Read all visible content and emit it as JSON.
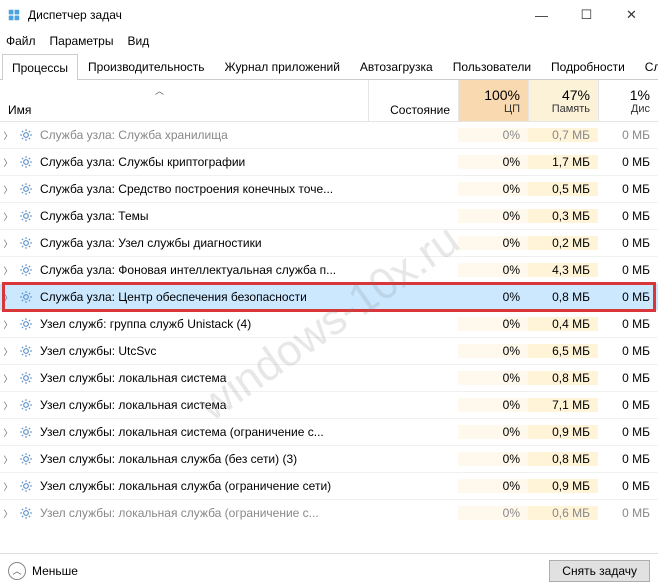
{
  "window": {
    "title": "Диспетчер задач"
  },
  "menu": {
    "file": "Файл",
    "options": "Параметры",
    "view": "Вид"
  },
  "tabs": {
    "processes": "Процессы",
    "performance": "Производительность",
    "app_history": "Журнал приложений",
    "startup": "Автозагрузка",
    "users": "Пользователи",
    "details": "Подробности",
    "services": "Службы"
  },
  "columns": {
    "name": "Имя",
    "status": "Состояние",
    "cpu_pct": "100%",
    "cpu_label": "ЦП",
    "mem_pct": "47%",
    "mem_label": "Память",
    "disk_pct": "1%",
    "disk_label": "Дис"
  },
  "rows": [
    {
      "name": "Служба узла: Служба хранилища",
      "cpu": "0%",
      "mem": "0,7 МБ",
      "disk": "0 МБ",
      "partial": true
    },
    {
      "name": "Служба узла: Службы криптографии",
      "cpu": "0%",
      "mem": "1,7 МБ",
      "disk": "0 МБ"
    },
    {
      "name": "Служба узла: Средство построения конечных точе...",
      "cpu": "0%",
      "mem": "0,5 МБ",
      "disk": "0 МБ"
    },
    {
      "name": "Служба узла: Темы",
      "cpu": "0%",
      "mem": "0,3 МБ",
      "disk": "0 МБ"
    },
    {
      "name": "Служба узла: Узел службы диагностики",
      "cpu": "0%",
      "mem": "0,2 МБ",
      "disk": "0 МБ"
    },
    {
      "name": "Служба узла: Фоновая интеллектуальная служба п...",
      "cpu": "0%",
      "mem": "4,3 МБ",
      "disk": "0 МБ"
    },
    {
      "name": "Служба узла: Центр обеспечения безопасности",
      "cpu": "0%",
      "mem": "0,8 МБ",
      "disk": "0 МБ",
      "selected": true
    },
    {
      "name": "Узел служб: группа служб Unistack (4)",
      "cpu": "0%",
      "mem": "0,4 МБ",
      "disk": "0 МБ"
    },
    {
      "name": "Узел службы: UtcSvc",
      "cpu": "0%",
      "mem": "6,5 МБ",
      "disk": "0 МБ"
    },
    {
      "name": "Узел службы: локальная система",
      "cpu": "0%",
      "mem": "0,8 МБ",
      "disk": "0 МБ"
    },
    {
      "name": "Узел службы: локальная система",
      "cpu": "0%",
      "mem": "7,1 МБ",
      "disk": "0 МБ"
    },
    {
      "name": "Узел службы: локальная система (ограничение с...",
      "cpu": "0%",
      "mem": "0,9 МБ",
      "disk": "0 МБ"
    },
    {
      "name": "Узел службы: локальная служба (без сети) (3)",
      "cpu": "0%",
      "mem": "0,8 МБ",
      "disk": "0 МБ"
    },
    {
      "name": "Узел службы: локальная служба (ограничение сети)",
      "cpu": "0%",
      "mem": "0,9 МБ",
      "disk": "0 МБ"
    },
    {
      "name": "Узел службы: локальная служба (ограничение с...",
      "cpu": "0%",
      "mem": "0,6 МБ",
      "disk": "0 МБ",
      "partial": true
    }
  ],
  "footer": {
    "fewer": "Меньше",
    "end_task": "Снять задачу"
  },
  "watermark": "windows-10x.ru"
}
